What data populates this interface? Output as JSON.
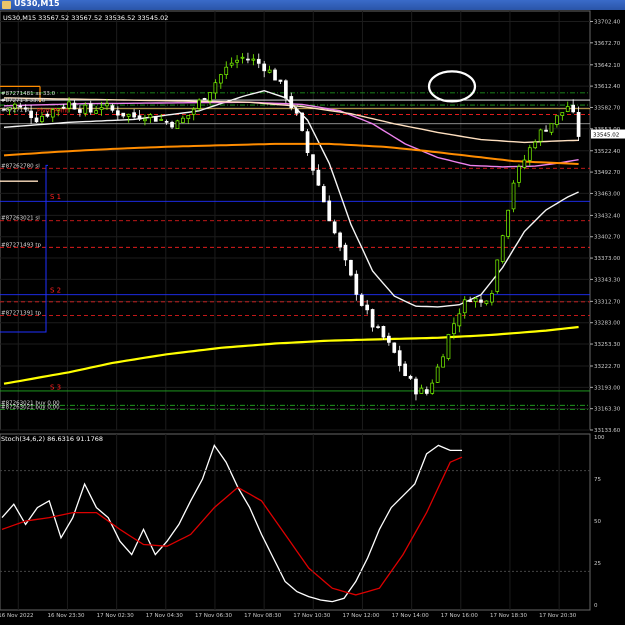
{
  "window": {
    "title": "US30,M15"
  },
  "info_line": "US30,M15  33567.52 33567.52 33536.52 33545.02",
  "colors": {
    "bull": "#7CFC00",
    "bear": "#ffffff",
    "ma_white": "#f5f5f5",
    "ma_pink": "#ee82ee",
    "ma_peach": "#ffe0c0",
    "ma_orange": "#ff8c00",
    "ma_yellow": "#ffff00",
    "stoch_main": "#ffffff",
    "stoch_signal": "#dd0000",
    "grid": "#1c1c1c",
    "level_red": "#ff2020",
    "level_green": "#22aa22",
    "level_blue": "#2030ff"
  },
  "chart_data": [
    {
      "type": "candlestick",
      "title": "US30,M15",
      "ylim": [
        33133.6,
        33717.0
      ],
      "y_ticks": [
        "33702.40",
        "33672.70",
        "33642.10",
        "33612.40",
        "33582.70",
        "33553.00",
        "33522.40",
        "33492.70",
        "33463.00",
        "33432.40",
        "33402.70",
        "33373.00",
        "33343.30",
        "33312.70",
        "33283.00",
        "33253.30",
        "33222.70",
        "33193.00",
        "33163.30",
        "33133.60"
      ],
      "x_ticks": [
        "16 Nov 2022",
        "16 Nov 23:30",
        "17 Nov 02:30",
        "17 Nov 04:30",
        "17 Nov 06:30",
        "17 Nov 08:30",
        "17 Nov 10:30",
        "17 Nov 12:00",
        "17 Nov 14:00",
        "17 Nov 16:00",
        "17 Nov 18:30",
        "17 Nov 20:30"
      ],
      "price_label": "33545.02",
      "anchors": [
        [
          0,
          33580
        ],
        [
          2,
          33586
        ],
        [
          4,
          33578
        ],
        [
          6,
          33568
        ],
        [
          8,
          33575
        ],
        [
          10,
          33583
        ],
        [
          12,
          33589
        ],
        [
          14,
          33582
        ],
        [
          16,
          33577
        ],
        [
          18,
          33586
        ],
        [
          20,
          33578
        ],
        [
          22,
          33574
        ],
        [
          24,
          33570
        ],
        [
          26,
          33573
        ],
        [
          28,
          33568
        ],
        [
          30,
          33563
        ],
        [
          32,
          33560
        ],
        [
          34,
          33572
        ],
        [
          36,
          33590
        ],
        [
          38,
          33608
        ],
        [
          40,
          33628
        ],
        [
          42,
          33645
        ],
        [
          44,
          33652
        ],
        [
          46,
          33648
        ],
        [
          48,
          33640
        ],
        [
          50,
          33625
        ],
        [
          52,
          33600
        ],
        [
          54,
          33570
        ],
        [
          56,
          33520
        ],
        [
          58,
          33475
        ],
        [
          60,
          33430
        ],
        [
          62,
          33385
        ],
        [
          64,
          33345
        ],
        [
          66,
          33310
        ],
        [
          68,
          33280
        ],
        [
          70,
          33262
        ],
        [
          72,
          33240
        ],
        [
          74,
          33210
        ],
        [
          76,
          33190
        ],
        [
          78,
          33185
        ],
        [
          80,
          33220
        ],
        [
          82,
          33265
        ],
        [
          84,
          33300
        ],
        [
          86,
          33320
        ],
        [
          88,
          33310
        ],
        [
          90,
          33330
        ],
        [
          92,
          33410
        ],
        [
          94,
          33480
        ],
        [
          96,
          33510
        ],
        [
          98,
          33540
        ],
        [
          100,
          33555
        ],
        [
          102,
          33568
        ],
        [
          104,
          33585
        ],
        [
          105,
          33570
        ],
        [
          106,
          33545
        ]
      ],
      "moving_averages": [
        {
          "name": "fast MA",
          "color": "#f5f5f5",
          "points": [
            [
              0,
              33555
            ],
            [
              12,
              33562
            ],
            [
              24,
              33566
            ],
            [
              36,
              33578
            ],
            [
              44,
              33598
            ],
            [
              48,
              33606
            ],
            [
              52,
              33596
            ],
            [
              56,
              33565
            ],
            [
              60,
              33505
            ],
            [
              64,
              33420
            ],
            [
              68,
              33355
            ],
            [
              72,
              33320
            ],
            [
              76,
              33306
            ],
            [
              80,
              33305
            ],
            [
              84,
              33308
            ],
            [
              88,
              33322
            ],
            [
              92,
              33360
            ],
            [
              96,
              33410
            ],
            [
              100,
              33440
            ],
            [
              104,
              33458
            ],
            [
              106,
              33465
            ]
          ]
        },
        {
          "name": "pink MA",
          "color": "#ee82ee",
          "points": [
            [
              0,
              33585
            ],
            [
              15,
              33588
            ],
            [
              30,
              33589
            ],
            [
              45,
              33590
            ],
            [
              55,
              33587
            ],
            [
              62,
              33578
            ],
            [
              68,
              33560
            ],
            [
              74,
              33532
            ],
            [
              80,
              33513
            ],
            [
              86,
              33502
            ],
            [
              92,
              33500
            ],
            [
              98,
              33501
            ],
            [
              102,
              33505
            ],
            [
              106,
              33510
            ]
          ]
        },
        {
          "name": "peach MA",
          "color": "#ffe0c0",
          "points": [
            [
              0,
              33596
            ],
            [
              15,
              33594
            ],
            [
              30,
              33592
            ],
            [
              45,
              33590
            ],
            [
              55,
              33584
            ],
            [
              64,
              33574
            ],
            [
              72,
              33560
            ],
            [
              80,
              33548
            ],
            [
              88,
              33538
            ],
            [
              96,
              33534
            ],
            [
              102,
              33536
            ],
            [
              106,
              33537
            ]
          ]
        },
        {
          "name": "orange MA",
          "color": "#ff8c00",
          "points": [
            [
              0,
              33516
            ],
            [
              10,
              33521
            ],
            [
              20,
              33525
            ],
            [
              30,
              33528
            ],
            [
              40,
              33530
            ],
            [
              50,
              33532
            ],
            [
              60,
              33532
            ],
            [
              70,
              33528
            ],
            [
              78,
              33522
            ],
            [
              86,
              33515
            ],
            [
              94,
              33508
            ],
            [
              100,
              33506
            ],
            [
              106,
              33504
            ]
          ]
        },
        {
          "name": "yellow MA",
          "color": "#ffff00",
          "points": [
            [
              0,
              33198
            ],
            [
              6,
              33206
            ],
            [
              12,
              33214
            ],
            [
              20,
              33227
            ],
            [
              30,
              33239
            ],
            [
              40,
              33248
            ],
            [
              50,
              33254
            ],
            [
              60,
              33258
            ],
            [
              70,
              33260
            ],
            [
              80,
              33262
            ],
            [
              90,
              33266
            ],
            [
              100,
              33272
            ],
            [
              106,
              33277
            ]
          ]
        }
      ],
      "levels": [
        {
          "price": 33593,
          "style": "solid",
          "color": "#ffffff",
          "label": ""
        },
        {
          "price": 33603,
          "style": "dashdot",
          "color": "#22aa22",
          "label": ""
        },
        {
          "price": 33586,
          "style": "dashdot",
          "color": "#22aa22",
          "label": ""
        },
        {
          "price": 33581,
          "style": "solid",
          "color": "#e8c060",
          "label": ""
        },
        {
          "price": 33573,
          "style": "dashed",
          "color": "#ff2020",
          "label": ""
        },
        {
          "price": 33560,
          "style": "solid",
          "color": "#bbbbbb",
          "label": ""
        },
        {
          "price": 33498,
          "style": "dashed",
          "color": "#ff2020",
          "label": "#87262780 sl"
        },
        {
          "price": 33452,
          "style": "solid",
          "color": "#2030ff",
          "label": ""
        },
        {
          "price": 33425,
          "style": "dashed",
          "color": "#ff2020",
          "label": "#87263021 sl"
        },
        {
          "price": 33388,
          "style": "dashed",
          "color": "#ff2020",
          "label": "#87271493 tp"
        },
        {
          "price": 33322,
          "style": "solid",
          "color": "#2030ff",
          "label": ""
        },
        {
          "price": 33312,
          "style": "dashed",
          "color": "#ff2020",
          "label": ""
        },
        {
          "price": 33293,
          "style": "dashed",
          "color": "#ff2020",
          "label": "#87271391 tp"
        },
        {
          "price": 33188,
          "style": "solid",
          "color": "#22aa22",
          "label": ""
        },
        {
          "price": 33168,
          "style": "dashdot",
          "color": "#22aa22",
          "label": "#87263021 buy 0.00"
        },
        {
          "price": 33162,
          "style": "dashdot",
          "color": "#22aa22",
          "label": "#87263021 buy 0.00"
        }
      ],
      "left_labels": [
        {
          "price": 33600,
          "text": "#87271481 ss 33.0"
        },
        {
          "price": 33590,
          "text": "#87271 s 33.00"
        },
        {
          "price": 33577,
          "text": "#87271 sl"
        }
      ],
      "pivot_label": {
        "text": "Pivot Point",
        "price": 33576
      },
      "sr_labels": [
        {
          "text": "S 1",
          "price": 33455
        },
        {
          "text": "S 2",
          "price": 33325
        },
        {
          "text": "S 3",
          "price": 33190
        }
      ]
    },
    {
      "type": "line",
      "title": "Stoch(34,6,2) 86.6316 91.1768",
      "ylim": [
        0,
        100
      ],
      "y_ticks": [
        "100",
        "75",
        "50",
        "25",
        "0"
      ],
      "series": [
        {
          "name": "main",
          "color": "#ffffff",
          "points": [
            [
              0,
              52
            ],
            [
              2,
              60
            ],
            [
              4,
              48
            ],
            [
              6,
              58
            ],
            [
              8,
              62
            ],
            [
              10,
              40
            ],
            [
              12,
              52
            ],
            [
              14,
              72
            ],
            [
              16,
              58
            ],
            [
              18,
              52
            ],
            [
              20,
              38
            ],
            [
              22,
              30
            ],
            [
              24,
              45
            ],
            [
              26,
              30
            ],
            [
              28,
              38
            ],
            [
              30,
              48
            ],
            [
              32,
              62
            ],
            [
              34,
              75
            ],
            [
              36,
              95
            ],
            [
              38,
              85
            ],
            [
              40,
              70
            ],
            [
              42,
              58
            ],
            [
              44,
              42
            ],
            [
              46,
              28
            ],
            [
              48,
              14
            ],
            [
              50,
              8
            ],
            [
              52,
              5
            ],
            [
              54,
              3
            ],
            [
              56,
              2
            ],
            [
              58,
              4
            ],
            [
              60,
              14
            ],
            [
              62,
              28
            ],
            [
              64,
              45
            ],
            [
              66,
              58
            ],
            [
              68,
              65
            ],
            [
              70,
              72
            ],
            [
              72,
              90
            ],
            [
              74,
              95
            ],
            [
              76,
              92
            ]
          ]
        },
        {
          "name": "signal",
          "color": "#dd0000",
          "points": [
            [
              0,
              45
            ],
            [
              4,
              50
            ],
            [
              8,
              52
            ],
            [
              12,
              55
            ],
            [
              16,
              55
            ],
            [
              20,
              45
            ],
            [
              24,
              36
            ],
            [
              28,
              35
            ],
            [
              32,
              42
            ],
            [
              36,
              58
            ],
            [
              40,
              70
            ],
            [
              44,
              62
            ],
            [
              48,
              42
            ],
            [
              52,
              22
            ],
            [
              56,
              10
            ],
            [
              60,
              6
            ],
            [
              64,
              10
            ],
            [
              68,
              30
            ],
            [
              72,
              55
            ],
            [
              76,
              85
            ],
            [
              78,
              88
            ]
          ]
        }
      ]
    }
  ]
}
